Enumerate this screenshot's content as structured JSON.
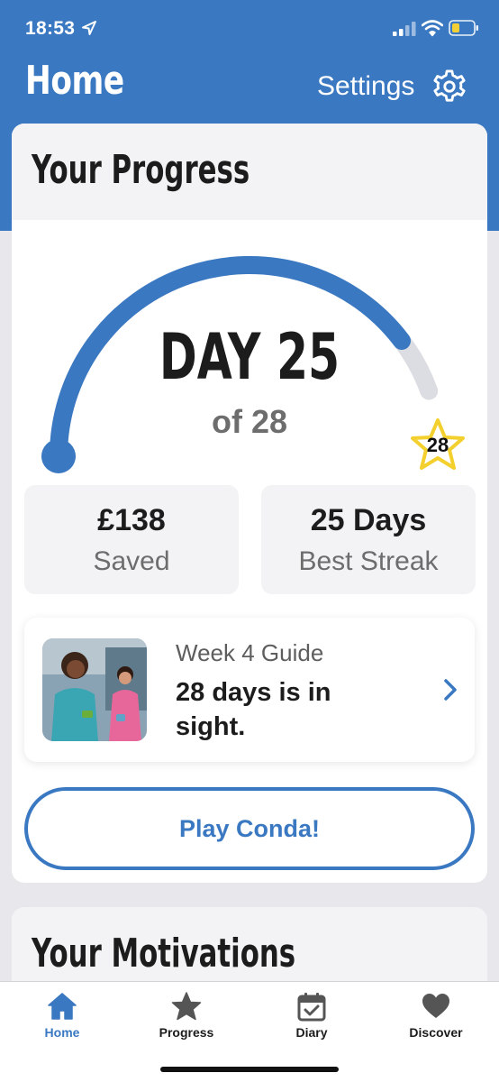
{
  "status_bar": {
    "time": "18:53",
    "icons": [
      "location-arrow-icon",
      "cellular-signal-icon",
      "wifi-icon",
      "battery-low-icon"
    ]
  },
  "header": {
    "title": "Home",
    "settings_label": "Settings",
    "settings_icon": "gear-icon"
  },
  "progress_card": {
    "title": "Your Progress",
    "day_label": "DAY 25",
    "of_label": "of 28",
    "current_day": 25,
    "total_days": 28,
    "goal_badge": "28",
    "stats": [
      {
        "value": "£138",
        "label": "Saved"
      },
      {
        "value": "25 Days",
        "label": "Best Streak"
      }
    ],
    "guide": {
      "eyebrow": "Week 4 Guide",
      "title": "28 days is in sight."
    },
    "play_button_label": "Play Conda!"
  },
  "motivations_card": {
    "title": "Your Motivations"
  },
  "tab_bar": {
    "items": [
      {
        "label": "Home",
        "icon": "home-icon",
        "active": true
      },
      {
        "label": "Progress",
        "icon": "star-icon",
        "active": false
      },
      {
        "label": "Diary",
        "icon": "calendar-check-icon",
        "active": false
      },
      {
        "label": "Discover",
        "icon": "heart-icon",
        "active": false
      }
    ]
  },
  "colors": {
    "brand_blue": "#3a78c2",
    "track_grey": "#dcdde2",
    "star_yellow": "#f3d02e"
  }
}
